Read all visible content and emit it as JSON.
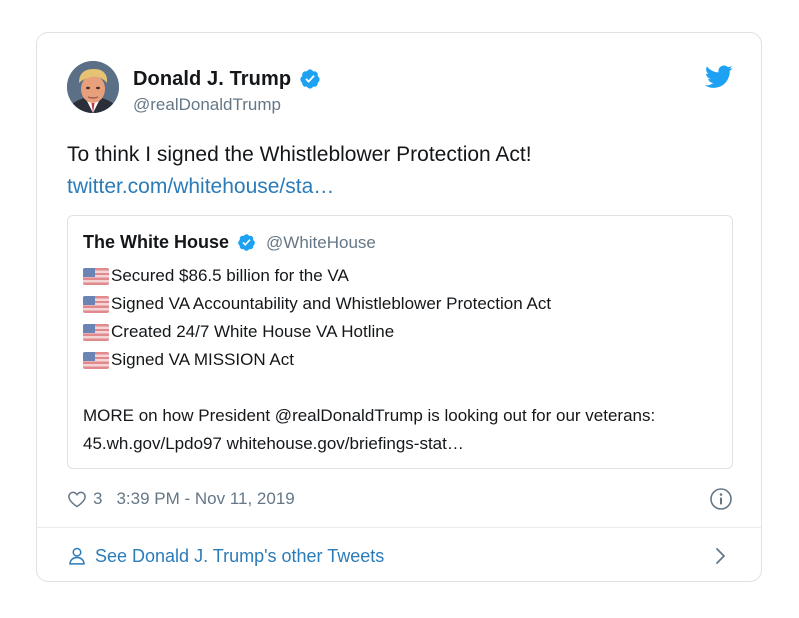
{
  "tweet": {
    "author": {
      "name": "Donald J. Trump",
      "handle": "@realDonaldTrump"
    },
    "text": "To think I signed the Whistleblower Protection Act!",
    "link": "twitter.com/whitehouse/sta…",
    "quote": {
      "name": "The White House",
      "handle": "@WhiteHouse",
      "lines": [
        "Secured $86.5 billion for the VA",
        "Signed VA Accountability and Whistleblower Protection Act",
        "Created 24/7 White House VA Hotline",
        "Signed VA MISSION Act"
      ],
      "more": "MORE on how President @realDonaldTrump is looking out for our veterans: 45.wh.gov/Lpdo97 whitehouse.gov/briefings-stat…"
    },
    "likes": "3",
    "timestamp": "3:39 PM - Nov 11, 2019",
    "footer_link": "See Donald J. Trump's other Tweets"
  },
  "colors": {
    "link": "#2b7bb9",
    "verified": "#1da1f2",
    "muted": "#657786"
  },
  "icons": {
    "verified": "verified-badge-icon",
    "brand": "twitter-bird-icon",
    "like": "heart-icon",
    "info": "info-icon",
    "profile": "person-icon",
    "chevron": "chevron-right-icon",
    "flag": "us-flag-icon"
  }
}
